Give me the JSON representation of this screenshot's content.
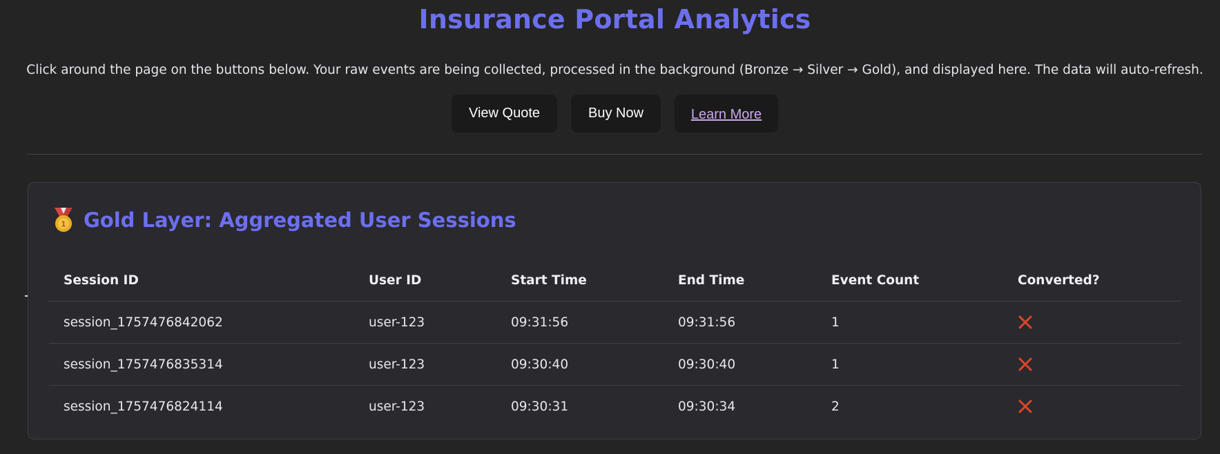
{
  "header": {
    "title": "Insurance Portal Analytics",
    "intro": "Click around the page on the buttons below. Your raw events are being collected, processed in the background (Bronze → Silver → Gold), and displayed here. The data will auto-refresh."
  },
  "actions": {
    "view_quote": "View Quote",
    "buy_now": "Buy Now",
    "learn_more": "Learn More"
  },
  "gold": {
    "icon": "medal-icon",
    "title": "Gold Layer: Aggregated User Sessions",
    "columns": [
      "Session ID",
      "User ID",
      "Start Time",
      "End Time",
      "Event Count",
      "Converted?"
    ],
    "rows": [
      {
        "session_id": "session_1757476842062",
        "user_id": "user-123",
        "start": "09:31:56",
        "end": "09:31:56",
        "count": "1",
        "converted": false
      },
      {
        "session_id": "session_1757476835314",
        "user_id": "user-123",
        "start": "09:30:40",
        "end": "09:30:40",
        "count": "1",
        "converted": false
      },
      {
        "session_id": "session_1757476824114",
        "user_id": "user-123",
        "start": "09:30:31",
        "end": "09:30:34",
        "count": "2",
        "converted": false
      }
    ]
  },
  "colors": {
    "accent": "#6b6ff0",
    "background": "#242424",
    "card": "#29292e",
    "link": "#c9a8ec",
    "cross": "#e0442c"
  }
}
